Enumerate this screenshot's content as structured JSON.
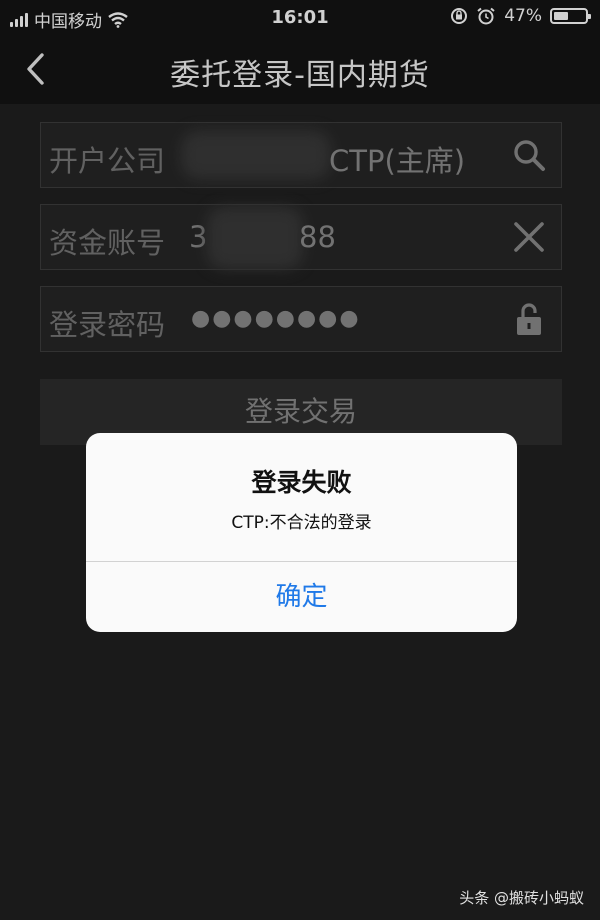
{
  "status_bar": {
    "carrier": "中国移动",
    "time": "16:01",
    "battery": "47%",
    "battery_level": 0.47
  },
  "nav": {
    "title": "委托登录-国内期货",
    "back_icon": "chevron-left-icon"
  },
  "form": {
    "company": {
      "label": "开户公司",
      "value": "CTP(主席)",
      "icon": "search-icon"
    },
    "account": {
      "label": "资金账号",
      "value_prefix": "3",
      "value_suffix": "88",
      "icon": "close-icon"
    },
    "password": {
      "label": "登录密码",
      "value": "●●●●●●●●",
      "icon": "unlock-icon"
    },
    "submit_label": "登录交易"
  },
  "alert": {
    "title": "登录失败",
    "message": "CTP:不合法的登录",
    "confirm_label": "确定"
  },
  "watermark": "头条 @搬砖小蚂蚁",
  "colors": {
    "background": "#202020",
    "nav": "#141414",
    "alert_button": "#1f79e8"
  }
}
